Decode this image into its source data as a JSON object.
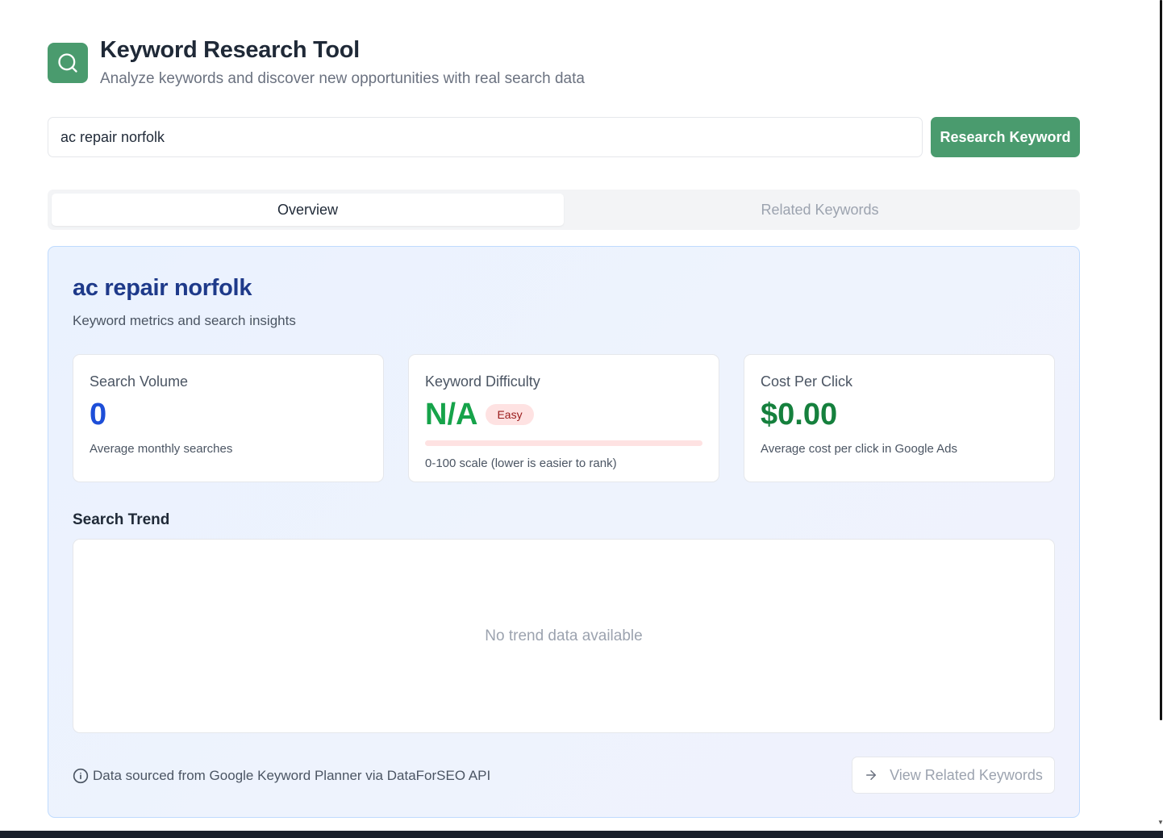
{
  "app": {
    "title": "Keyword Research Tool",
    "subtitle": "Analyze keywords and discover new opportunities with real search data",
    "logo_icon": "search-icon",
    "accent_color": "#4a9b6e"
  },
  "search": {
    "value": "ac repair norfolk",
    "button_label": "Research Keyword"
  },
  "tabs": [
    {
      "label": "Overview",
      "active": true
    },
    {
      "label": "Related Keywords",
      "active": false
    }
  ],
  "overview": {
    "keyword": "ac repair norfolk",
    "subtitle": "Keyword metrics and search insights",
    "metrics": {
      "search_volume": {
        "label": "Search Volume",
        "value": "0",
        "note": "Average monthly searches"
      },
      "keyword_difficulty": {
        "label": "Keyword Difficulty",
        "value": "N/A",
        "badge": "Easy",
        "note": "0-100 scale (lower is easier to rank)",
        "level": 0
      },
      "cpc": {
        "label": "Cost Per Click",
        "value": "$0.00",
        "note": "Average cost per click in Google Ads"
      }
    },
    "trend": {
      "title": "Search Trend",
      "empty_message": "No trend data available"
    },
    "footer": {
      "note": "Data sourced from Google Keyword Planner via DataForSEO API",
      "note_icon": "info-icon",
      "related_button_label": "View Related Keywords",
      "related_button_icon": "arrow-right-icon"
    }
  }
}
